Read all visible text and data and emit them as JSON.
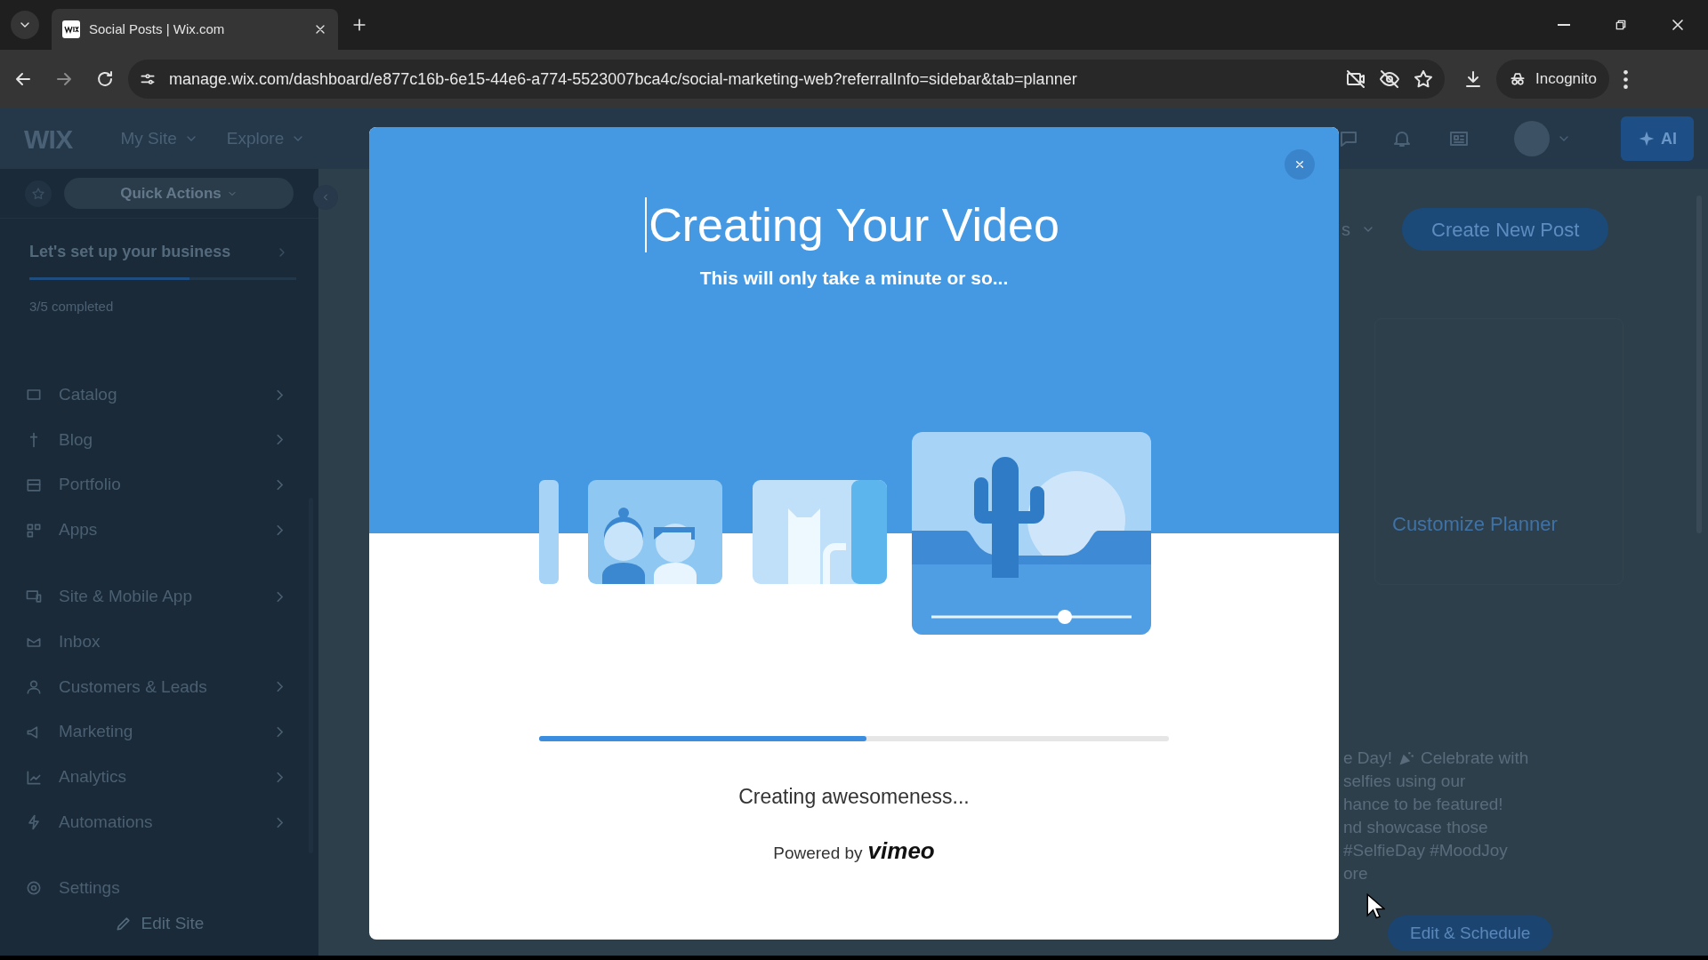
{
  "browser": {
    "tabs": [
      {
        "title": "Social Posts | Wix.com",
        "selected": true
      }
    ],
    "url": "manage.wix.com/dashboard/e877c16b-6e15-44e6-a774-5523007bca4c/social-marketing-web?referralInfo=sidebar&tab=planner",
    "incognito_label": "Incognito"
  },
  "topbar": {
    "logo": "WIX",
    "menus": [
      "My Site",
      "Explore"
    ],
    "ai_label": "AI"
  },
  "sidebar": {
    "quick_actions": "Quick Actions",
    "setup": {
      "title": "Let's set up your business",
      "level": 0.6,
      "progress": "3/5 completed"
    },
    "groups": [
      [
        {
          "label": "Catalog",
          "has_arrow": true
        },
        {
          "label": "Blog",
          "has_arrow": true
        },
        {
          "label": "Portfolio",
          "has_arrow": true
        },
        {
          "label": "Apps",
          "has_arrow": true
        }
      ],
      [
        {
          "label": "Site & Mobile App",
          "has_arrow": true
        },
        {
          "label": "Inbox",
          "has_arrow": false
        },
        {
          "label": "Customers & Leads",
          "has_arrow": true
        },
        {
          "label": "Marketing",
          "has_arrow": true
        },
        {
          "label": "Analytics",
          "has_arrow": true
        },
        {
          "label": "Automations",
          "has_arrow": true
        }
      ],
      [
        {
          "label": "Settings",
          "has_arrow": false
        }
      ]
    ],
    "edit_site": "Edit Site"
  },
  "content": {
    "filter_partial": "s",
    "create_button": "Create New Post",
    "customize_link": "Customize Planner",
    "post_text": {
      "first_before_icon": "e Day!",
      "first_after_icon": "Celebrate with",
      "lines": [
        "selfies using our",
        "hance to be featured!",
        "nd showcase those",
        "#SelfieDay #MoodJoy",
        "ore"
      ]
    },
    "schedule_button": "Edit & Schedule"
  },
  "modal": {
    "title": "Creating Your Video",
    "subtitle": "This will only take a minute or so...",
    "progress": {
      "level": 0.52
    },
    "status": "Creating awesomeness...",
    "powered_by": "Powered by",
    "brand": "vimeo"
  }
}
